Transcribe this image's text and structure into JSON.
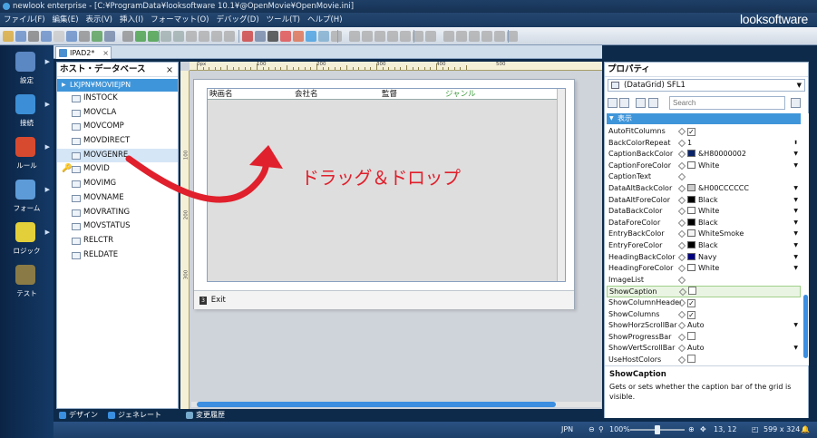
{
  "window": {
    "title": "newlook enterprise - [C:¥ProgramData¥looksoftware 10.1¥@OpenMovie¥OpenMovie.ini]",
    "brand": "looksoftware"
  },
  "menu": [
    "ファイル(F)",
    "編集(E)",
    "表示(V)",
    "挿入(I)",
    "フォーマット(O)",
    "デバッグ(D)",
    "ツール(T)",
    "ヘルプ(H)"
  ],
  "nav": [
    {
      "label": "設定",
      "icon": "gear-icon",
      "color": "#5b87c2"
    },
    {
      "label": "接続",
      "icon": "globe-icon",
      "color": "#3c8fd6"
    },
    {
      "label": "ルール",
      "icon": "cubes-icon",
      "color": "#d84a2f"
    },
    {
      "label": "フォーム",
      "icon": "form-icon",
      "color": "#5d9bd8"
    },
    {
      "label": "ロジック",
      "icon": "logic-icon",
      "color": "#e3cf3a"
    },
    {
      "label": "テスト",
      "icon": "test-icon",
      "color": "#8a7a45"
    }
  ],
  "doctab": {
    "label": "IPAD2*",
    "close": "×"
  },
  "tree": {
    "title": "ホスト・データベース",
    "close": "×",
    "root": "LKJPN¥MOVIEJPN",
    "items": [
      "INSTOCK",
      "MOVCLA",
      "MOVCOMP",
      "MOVDIRECT",
      "MOVGENRE",
      "MOVID",
      "MOVIMG",
      "MOVNAME",
      "MOVRATING",
      "MOVSTATUS",
      "RELCTR",
      "RELDATE"
    ],
    "selected": "MOVGENRE",
    "key_item": "MOVID"
  },
  "bottom_tabs": [
    "デザイン",
    "ジェネレート",
    "変更履歴"
  ],
  "ruler": [
    "0px",
    "100",
    "200",
    "300",
    "400",
    "500"
  ],
  "ruler_v": [
    "100",
    "200",
    "300"
  ],
  "grid": {
    "columns": [
      "映画名",
      "会社名",
      "監督",
      "ジャンル"
    ]
  },
  "exit": {
    "key": "3",
    "label": "Exit"
  },
  "annotation": "ドラッグ＆ドロップ",
  "props": {
    "title": "プロパティ",
    "object": "(DataGrid) SFL1",
    "search_placeholder": "Search",
    "category": "表示",
    "rows": [
      {
        "name": "AutoFitColumns",
        "value": "",
        "check": true
      },
      {
        "name": "BackColorRepeat",
        "value": "1",
        "spin": true
      },
      {
        "name": "CaptionBackColor",
        "value": "&H80000002",
        "color": "#0a246a",
        "dd": true
      },
      {
        "name": "CaptionForeColor",
        "value": "White",
        "color": "#ffffff",
        "dd": true
      },
      {
        "name": "CaptionText",
        "value": ""
      },
      {
        "name": "DataAltBackColor",
        "value": "&H00CCCCCC",
        "color": "#cccccc",
        "dd": true
      },
      {
        "name": "DataAltForeColor",
        "value": "Black",
        "color": "#000000",
        "dd": true
      },
      {
        "name": "DataBackColor",
        "value": "White",
        "color": "#ffffff",
        "dd": true
      },
      {
        "name": "DataForeColor",
        "value": "Black",
        "color": "#000000",
        "dd": true
      },
      {
        "name": "EntryBackColor",
        "value": "WhiteSmoke",
        "color": "#f5f5f5",
        "dd": true
      },
      {
        "name": "EntryForeColor",
        "value": "Black",
        "color": "#000000",
        "dd": true
      },
      {
        "name": "HeadingBackColor",
        "value": "Navy",
        "color": "#000080",
        "dd": true
      },
      {
        "name": "HeadingForeColor",
        "value": "White",
        "color": "#ffffff",
        "dd": true
      },
      {
        "name": "ImageList",
        "value": ""
      },
      {
        "name": "ShowCaption",
        "value": "",
        "check": false,
        "selected": true
      },
      {
        "name": "ShowColumnHeaders",
        "value": "",
        "check": true
      },
      {
        "name": "ShowColumns",
        "value": "",
        "check": true
      },
      {
        "name": "ShowHorzScrollBar",
        "value": "Auto",
        "dd": true
      },
      {
        "name": "ShowProgressBar",
        "value": "",
        "check": false
      },
      {
        "name": "ShowVertScrollBar",
        "value": "Auto",
        "dd": true
      },
      {
        "name": "UseHostColors",
        "value": "",
        "check": false
      }
    ],
    "desc_title": "ShowCaption",
    "desc_body": "Gets or sets whether the caption bar of the grid is visible."
  },
  "status": {
    "lang": "JPN",
    "zoom": "100%",
    "coords": "13, 12",
    "size": "599 x 324",
    "zoom_level": 0.5
  }
}
